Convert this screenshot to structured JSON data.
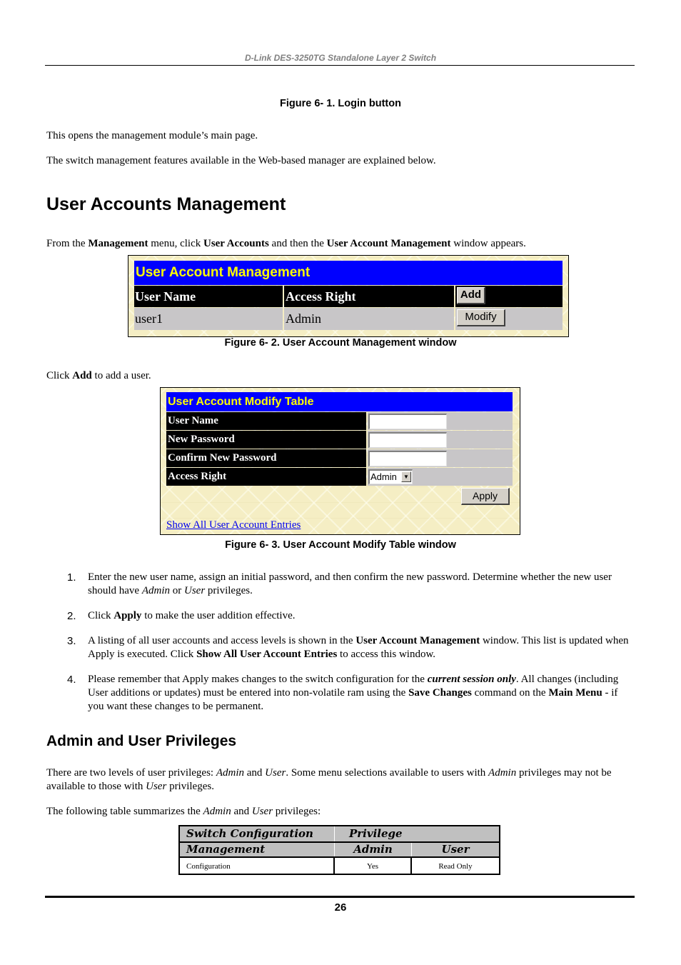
{
  "page_header": "D-Link DES-3250TG Standalone Layer 2 Switch",
  "captions": {
    "fig1": "Figure 6- 1.  Login button",
    "fig2": "Figure 6- 2.  User Account Management window",
    "fig3": "Figure 6- 3.  User Account Modify Table window"
  },
  "intro": {
    "p1": "This opens the management module’s main page.",
    "p2": "The switch management features available in the Web-based manager are explained below."
  },
  "section1": {
    "title": "User Accounts Management",
    "para": {
      "t1": "From the ",
      "b1": "Management",
      "t2": " menu, click ",
      "b2": "User Accounts",
      "t3": " and then the ",
      "b3": "User Account Management",
      "t4": " window appears."
    }
  },
  "fig_management": {
    "title": "User Account Management",
    "columns": [
      "User Name",
      "Access Right"
    ],
    "add_button": "Add",
    "rows": [
      {
        "user_name": "user1",
        "access_right": "Admin",
        "action": "Modify"
      }
    ]
  },
  "click_add": {
    "t1": "Click ",
    "b1": "Add",
    "t2": " to add a user."
  },
  "fig_modify": {
    "title": "User Account Modify Table",
    "fields": {
      "user_name": {
        "label": "User Name",
        "value": ""
      },
      "new_password": {
        "label": "New Password",
        "value": ""
      },
      "confirm_password": {
        "label": "Confirm New Password",
        "value": ""
      },
      "access_right": {
        "label": "Access Right",
        "selected": "Admin"
      }
    },
    "apply_button": "Apply",
    "show_all_link": "Show All User Account Entries"
  },
  "steps": [
    {
      "num": "1.",
      "parts": {
        "a": "Enter the new user name, assign an initial password, and then confirm the new password. Determine whether the new user should have ",
        "i1": "Admin",
        "b": " or ",
        "i2": "User",
        "c": " privileges."
      }
    },
    {
      "num": "2.",
      "parts": {
        "a": "Click ",
        "b1": "Apply",
        "c": " to make the user addition effective."
      }
    },
    {
      "num": "3.",
      "parts": {
        "a": "A listing of all user accounts and access levels is shown in the ",
        "b1": "User Account Management",
        "c": " window. This list is updated when Apply is executed. Click ",
        "b2": "Show All User Account Entries",
        "d": " to access this window."
      }
    },
    {
      "num": "4.",
      "parts": {
        "a": "Please remember that Apply makes changes to the switch configuration for the ",
        "bi": "current session only",
        "c": ". All changes (including User additions or updates) must be entered into non-volatile ram using the ",
        "b1": "Save Changes",
        "d": " command on the ",
        "b2": "Main Menu",
        "e": " - if you want these changes to be permanent."
      }
    }
  ],
  "section2": {
    "title": "Admin and User Privileges",
    "p1": {
      "a": "There are two levels of user privileges: ",
      "i1": "Admin",
      "b": " and ",
      "i2": "User",
      "c": ". Some menu selections available to users with ",
      "i3": "Admin",
      "d": " privileges may not be available to those with ",
      "i4": "User",
      "e": " privileges."
    },
    "p2": {
      "a": "The following table summarizes the ",
      "i1": "Admin",
      "b": " and ",
      "i2": "User",
      "c": " privileges:"
    }
  },
  "privilege_table": {
    "header1": {
      "col1": "Switch Configuration",
      "col2": "Privilege"
    },
    "header2": {
      "col1": "Management",
      "col2": "Admin",
      "col3": "User"
    },
    "rows": [
      {
        "item": "Configuration",
        "admin": "Yes",
        "user": "Read Only"
      }
    ]
  },
  "page_number": "26"
}
